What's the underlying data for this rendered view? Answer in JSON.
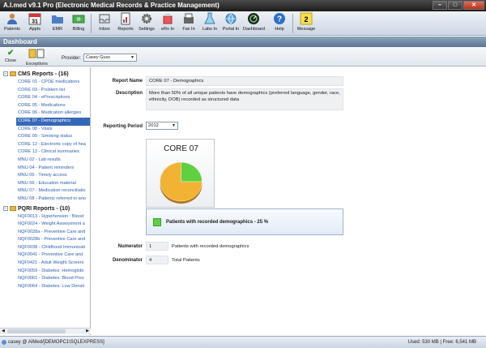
{
  "window": {
    "title": "A.I.med v9.1 Pro (Electronic Medical Records & Practice Management)",
    "controls": [
      "–",
      "□",
      "✕"
    ]
  },
  "toolbar": {
    "buttons": [
      {
        "label": "Patients",
        "icon": "person-icon"
      },
      {
        "label": "Appts",
        "icon": "calendar-icon"
      },
      {
        "label": "EMR",
        "icon": "folder-icon"
      },
      {
        "label": "Billing",
        "icon": "money-icon"
      },
      {
        "label": "Inbox",
        "icon": "inbox-icon"
      },
      {
        "label": "Reports",
        "icon": "report-icon"
      },
      {
        "label": "Settings",
        "icon": "gear-icon"
      },
      {
        "label": "eRx In",
        "icon": "erx-icon"
      },
      {
        "label": "Fax In",
        "icon": "fax-icon"
      },
      {
        "label": "Labs In",
        "icon": "lab-icon"
      },
      {
        "label": "Portal In",
        "icon": "portal-icon"
      },
      {
        "label": "Dashboard",
        "icon": "dashboard-icon"
      },
      {
        "label": "Help",
        "icon": "help-icon"
      },
      {
        "label": "Message",
        "icon": "message-icon",
        "badge": "2"
      }
    ],
    "calendar_day": "31"
  },
  "dashboard": {
    "header": "Dashboard",
    "close_label": "Close",
    "exceptions_label": "Exceptions",
    "provider_label": "Provider:",
    "provider_value": "Casey Guss"
  },
  "sidebar": {
    "groups": [
      {
        "title": "CMS Reports - (16)",
        "items": [
          "CORE 01 - CPOE medications",
          "CORE 03 - Problem list",
          "CORE 04 - ePrescriptions",
          "CORE 05 - Medications",
          "CORE 06 - Medication allergies",
          "CORE 07 - Demographics",
          "CORE 08 - Vitals",
          "CORE 09 - Smoking status",
          "CORE 12 - Electronic copy of hea",
          "CORE 13 - Clinical summaries",
          "MNU 02 - Lab results",
          "MNU 04 - Patient reminders",
          "MNU 05 - Timely access",
          "MNU 06 - Education material",
          "MNU 07 - Medication reconciliatio",
          "MNU 08 - Patients referred to ano"
        ],
        "selected_index": 5
      },
      {
        "title": "PQRI Reports - (10)",
        "items": [
          "NQF0013 - Hypertension : Blood",
          "NQF0024 - Weight Assessment a",
          "NQF0028a - Preventive Care and",
          "NQF0028b - Preventive Care and",
          "NQF0038 - Childhood Immunizati",
          "NQF0041 - Preventive Care and",
          "NQF0421 - Adult Weight Screeni",
          "NQF0059 - Diabetes: Hemoglobi",
          "NQF0061 - Diabetes: Blood Pres",
          "NQF0064 - Diabetes: Low Densit"
        ]
      }
    ]
  },
  "report": {
    "name_label": "Report Name",
    "name_value": "CORE 07 - Demographics",
    "description_label": "Description",
    "description_value": "More than 50% of all unique patients have demographics (preferred language, gender, race, ethnicity, DOB) recorded as structured data",
    "period_label": "Reporting Period",
    "period_value": "2012",
    "chart_title": "CORE 07",
    "legend_text": "Patients with recorded demographics - 25 %",
    "numerator_label": "Numerator",
    "numerator_value": "1",
    "numerator_desc": "Patients with recorded demographics",
    "denominator_label": "Denominator",
    "denominator_value": "4",
    "denominator_desc": "Total Patients"
  },
  "chart_data": {
    "type": "pie",
    "title": "CORE 07",
    "slices": [
      {
        "name": "Patients with recorded demographics",
        "value": 25,
        "color": "#5fd03f"
      },
      {
        "value": 75,
        "color": "#f2b233"
      }
    ]
  },
  "status": {
    "left": "casey @ AIMed/[DEMOPC1\\SQLEXPRESS]",
    "right": "Used: 530 MB | Free: 6,541 MB"
  },
  "colors": {
    "selection": "#3568b8",
    "link": "#2c5fb0",
    "accent_green": "#5fd03f",
    "accent_orange": "#f2b233"
  }
}
